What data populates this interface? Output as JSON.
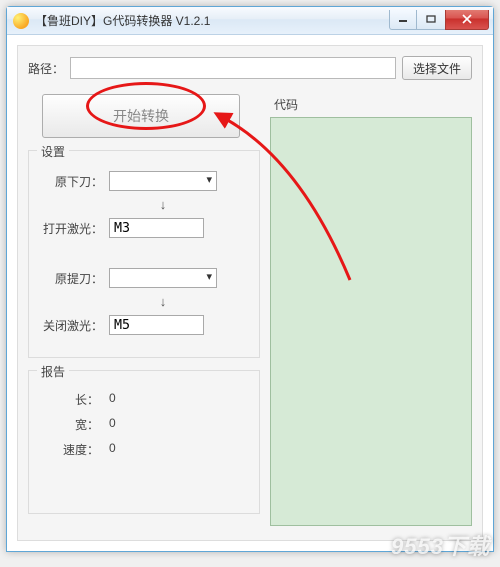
{
  "window": {
    "title": "【鲁班DIY】G代码转换器 V1.2.1"
  },
  "path": {
    "label": "路径：",
    "value": "",
    "browse_label": "选择文件"
  },
  "convert": {
    "label": "开始转换"
  },
  "settings": {
    "title": "设置",
    "orig_down_label": "原下刀：",
    "orig_down_value": "",
    "laser_on_label": "打开激光：",
    "laser_on_value": "M3",
    "orig_up_label": "原提刀：",
    "orig_up_value": "",
    "laser_off_label": "关闭激光：",
    "laser_off_value": "M5",
    "arrow": "↓"
  },
  "report": {
    "title": "报告",
    "length_label": "长：",
    "length_value": "0",
    "width_label": "宽：",
    "width_value": "0",
    "speed_label": "速度：",
    "speed_value": "0"
  },
  "code": {
    "title": "代码"
  },
  "watermark": "9553下载"
}
